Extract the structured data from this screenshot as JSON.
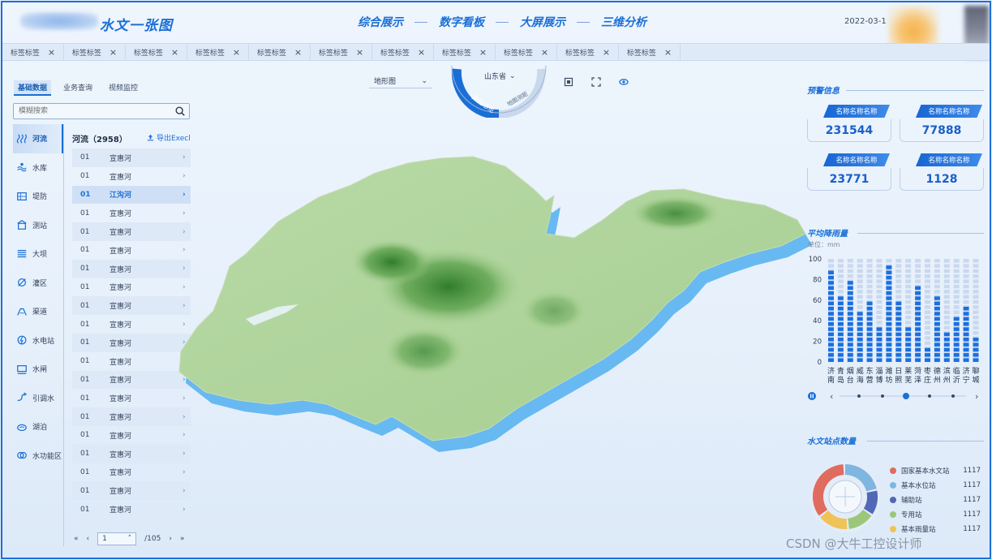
{
  "header": {
    "title": "水文一张图",
    "nav": [
      "综合展示",
      "数字看板",
      "大屏展示",
      "三维分析"
    ],
    "date": "2022-03-1"
  },
  "tags": [
    {
      "label": "标签标签"
    },
    {
      "label": "标签标签"
    },
    {
      "label": "标签标签"
    },
    {
      "label": "标签标签"
    },
    {
      "label": "标签标签"
    },
    {
      "label": "标签标签"
    },
    {
      "label": "标签标签"
    },
    {
      "label": "标签标签"
    },
    {
      "label": "标签标签"
    },
    {
      "label": "标签标签"
    },
    {
      "label": "标签标签"
    }
  ],
  "left": {
    "tabs": [
      "基础数据",
      "业务查询",
      "视频监控"
    ],
    "search_placeholder": "模糊搜索",
    "categories": [
      {
        "label": "河流",
        "icon": "river-icon"
      },
      {
        "label": "水库",
        "icon": "reservoir-icon"
      },
      {
        "label": "堤防",
        "icon": "dike-icon"
      },
      {
        "label": "测站",
        "icon": "station-icon"
      },
      {
        "label": "大坝",
        "icon": "dam-icon"
      },
      {
        "label": "灌区",
        "icon": "irrigation-icon"
      },
      {
        "label": "渠道",
        "icon": "channel-icon"
      },
      {
        "label": "水电站",
        "icon": "hydropower-icon"
      },
      {
        "label": "水闸",
        "icon": "sluice-icon"
      },
      {
        "label": "引调水",
        "icon": "water-diversion-icon"
      },
      {
        "label": "湖泊",
        "icon": "lake-icon"
      },
      {
        "label": "水功能区",
        "icon": "water-function-icon"
      }
    ],
    "list_title": "河流（2958）",
    "export_label": "导出Execl",
    "rows": [
      {
        "no": "01",
        "name": "宣惠河"
      },
      {
        "no": "01",
        "name": "宣惠河"
      },
      {
        "no": "01",
        "name": "江沟河"
      },
      {
        "no": "01",
        "name": "宣惠河"
      },
      {
        "no": "01",
        "name": "宣惠河"
      },
      {
        "no": "01",
        "name": "宣惠河"
      },
      {
        "no": "01",
        "name": "宣惠河"
      },
      {
        "no": "01",
        "name": "宣惠河"
      },
      {
        "no": "01",
        "name": "宣惠河"
      },
      {
        "no": "01",
        "name": "宣惠河"
      },
      {
        "no": "01",
        "name": "宣惠河"
      },
      {
        "no": "01",
        "name": "宣惠河"
      },
      {
        "no": "01",
        "name": "宣惠河"
      },
      {
        "no": "01",
        "name": "宣惠河"
      },
      {
        "no": "01",
        "name": "宣惠河"
      },
      {
        "no": "01",
        "name": "宣惠河"
      },
      {
        "no": "01",
        "name": "宣惠河"
      },
      {
        "no": "01",
        "name": "宣惠河"
      },
      {
        "no": "01",
        "name": "宣惠河"
      },
      {
        "no": "01",
        "name": "宣惠河"
      }
    ],
    "pager": {
      "current": "1",
      "total": "/105"
    }
  },
  "map": {
    "layer_select": "地形图",
    "province_select": "山东省",
    "dial_left": "数据总览",
    "dial_right": "地图测距"
  },
  "right": {
    "warning_title": "预警信息",
    "cards": [
      {
        "label": "名称名称名称",
        "value": "231544"
      },
      {
        "label": "名称名称名称",
        "value": "77888"
      },
      {
        "label": "名称名称名称",
        "value": "23771"
      },
      {
        "label": "名称名称名称",
        "value": "1128"
      }
    ],
    "rain_title": "平均降雨量",
    "rain_unit": "单位：mm",
    "station_title": "水文站点数量",
    "stations": [
      {
        "name": "国家基本水文站",
        "value": "1117",
        "color": "#e06b5f"
      },
      {
        "name": "基本水位站",
        "value": "1117",
        "color": "#7fb6e0"
      },
      {
        "name": "辅助站",
        "value": "1117",
        "color": "#5267b8"
      },
      {
        "name": "专用站",
        "value": "1117",
        "color": "#9bc77a"
      },
      {
        "name": "基本雨量站",
        "value": "1117",
        "color": "#f0c25a"
      }
    ]
  },
  "chart_data": {
    "type": "bar",
    "title": "平均降雨量",
    "ylabel": "单位：mm",
    "ylim": [
      0,
      100
    ],
    "yticks": [
      0,
      20,
      40,
      60,
      80,
      100
    ],
    "categories": [
      "济南",
      "青岛",
      "烟台",
      "威海",
      "东营",
      "淄博",
      "潍坊",
      "日照",
      "莱芜",
      "菏泽",
      "枣庄",
      "德州",
      "滨州",
      "临沂",
      "济宁",
      "聊城"
    ],
    "series": [
      {
        "values": [
          90,
          65,
          80,
          50,
          60,
          35,
          95,
          60,
          35,
          75,
          15,
          65,
          30,
          45,
          55,
          25
        ]
      }
    ],
    "background_bar": 100,
    "color": "#1a6fe0"
  },
  "watermark": "CSDN @大牛工控设计师"
}
